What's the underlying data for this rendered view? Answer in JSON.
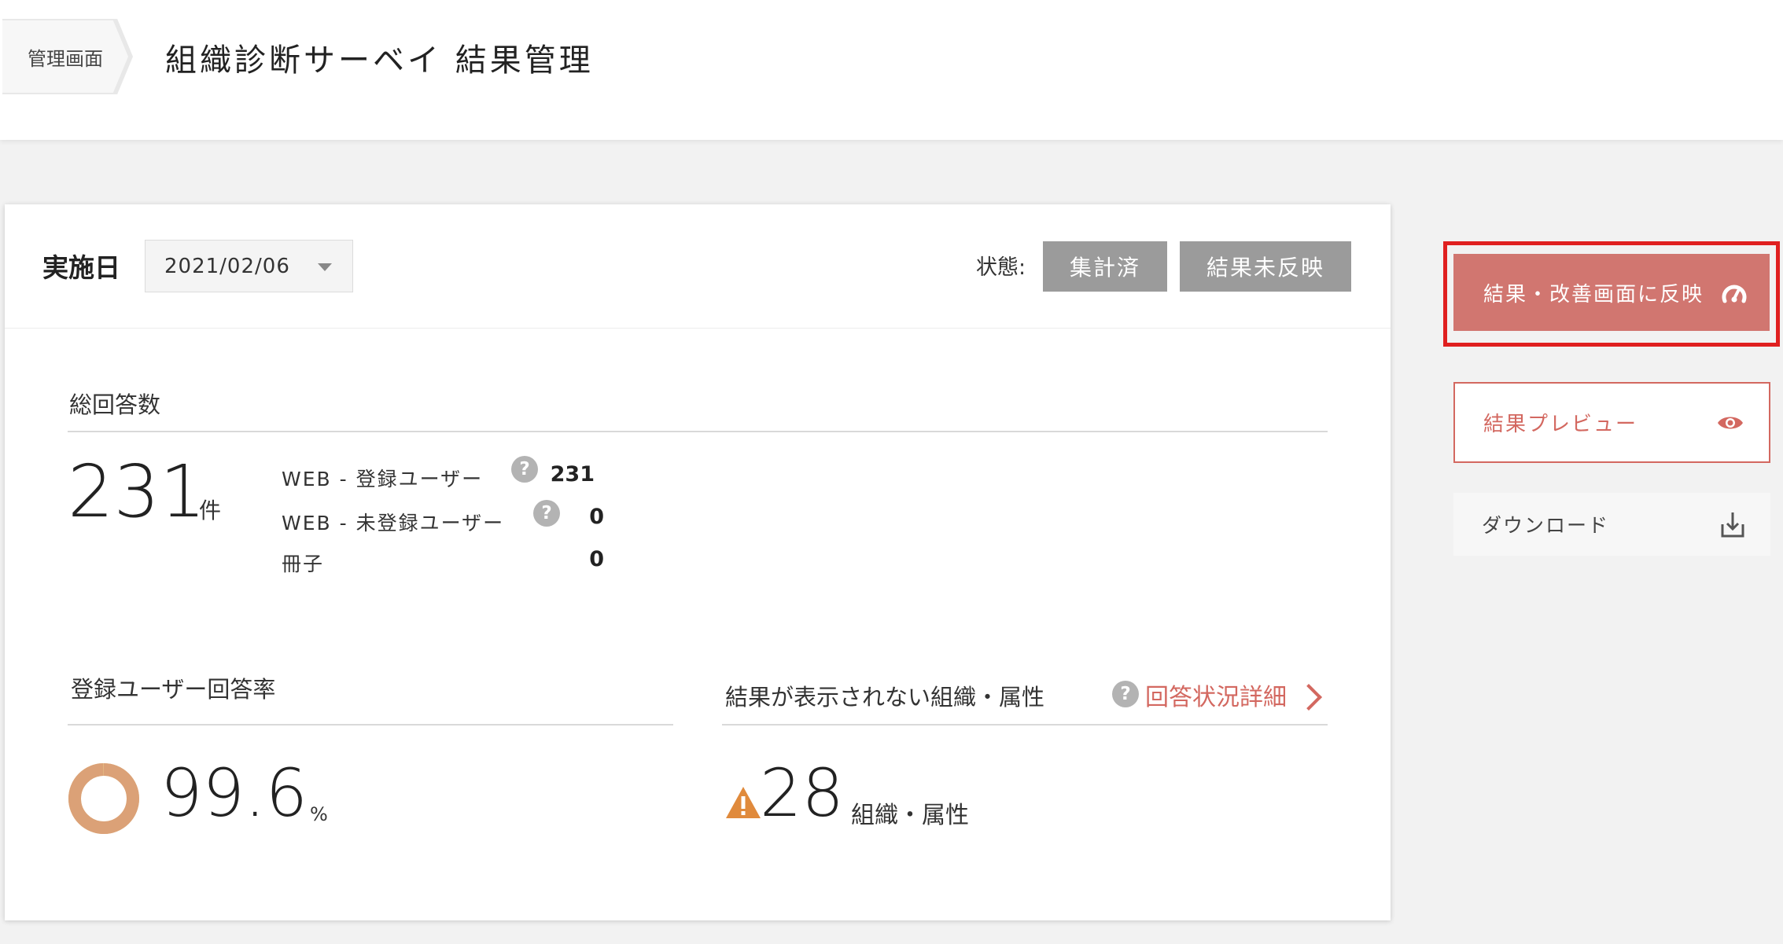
{
  "header": {
    "breadcrumb": "管理画面",
    "title": "組織診断サーベイ 結果管理"
  },
  "filter": {
    "date_label": "実施日",
    "date_value": "2021/02/06",
    "status_label": "状態:",
    "status_badges": [
      "集計済",
      "結果未反映"
    ]
  },
  "total_responses": {
    "title": "総回答数",
    "count": "231",
    "unit": "件",
    "breakdown": [
      {
        "label": "WEB - 登録ユーザー",
        "value": "231",
        "help": true
      },
      {
        "label": "WEB - 未登録ユーザー",
        "value": "0",
        "help": true
      },
      {
        "label": "冊子",
        "value": "0",
        "help": false
      }
    ]
  },
  "response_rate": {
    "title": "登録ユーザー回答率",
    "value": "99.6",
    "unit": "%",
    "fraction": 0.996,
    "colors": {
      "filled": "#dba177",
      "remaining": "#e9c98a"
    }
  },
  "hidden_results": {
    "title": "結果が表示されない組織・属性",
    "link_label": "回答状況詳細",
    "count": "28",
    "unit": "組織・属性",
    "warning_color": "#e08a3c"
  },
  "actions": {
    "reflect_label": "結果・改善画面に反映",
    "preview_label": "結果プレビュー",
    "download_label": "ダウンロード"
  },
  "colors": {
    "accent": "#d36860",
    "reflect_button": "#d17670",
    "highlight_border": "#e02020",
    "badge_gray": "#9b9b9b"
  },
  "icons": [
    "gauge-icon",
    "eye-icon",
    "download-icon",
    "help-icon",
    "warning-icon",
    "chevron-right-icon",
    "caret-down-icon"
  ]
}
